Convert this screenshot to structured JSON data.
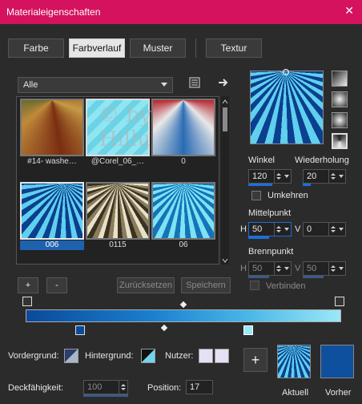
{
  "window": {
    "title": "Materialeigenschaften"
  },
  "tabs": [
    {
      "label": "Farbe"
    },
    {
      "label": "Farbverlauf"
    },
    {
      "label": "Muster"
    },
    {
      "label": "Textur"
    }
  ],
  "library": {
    "filter_value": "Alle",
    "tiles": [
      {
        "caption": "#14- washe…"
      },
      {
        "caption": "@Corel_06_…"
      },
      {
        "caption": "0"
      },
      {
        "caption": "006"
      },
      {
        "caption": "0115"
      },
      {
        "caption": "06"
      }
    ],
    "watermark": "© by Hillu"
  },
  "controls": {
    "angle_label": "Winkel",
    "angle_value": "120",
    "repeat_label": "Wiederholung",
    "repeat_value": "20",
    "invert_label": "Umkehren",
    "midpoint_label": "Mittelpunkt",
    "midpoint_h_label": "H",
    "midpoint_h_value": "50",
    "midpoint_v_label": "V",
    "midpoint_v_value": "0",
    "focal_label": "Brennpunkt",
    "focal_h_label": "H",
    "focal_h_value": "50",
    "focal_v_label": "V",
    "focal_v_value": "50",
    "link_label": "Verbinden"
  },
  "editor": {
    "add_label": "+",
    "remove_label": "-",
    "reset_label": "Zurücksetzen",
    "save_label": "Speichern"
  },
  "bottom": {
    "fg_label": "Vordergrund:",
    "bg_label": "Hintergrund:",
    "user_label": "Nutzer:",
    "opacity_label": "Deckfähigkeit:",
    "opacity_value": "100",
    "position_label": "Position:",
    "position_value": "17",
    "current_label": "Aktuell",
    "previous_label": "Vorher",
    "plus_label": "+"
  },
  "colors": {
    "titlebar": "#d4125d",
    "accent": "#1e62ad",
    "previous": "#0e4f9e"
  }
}
